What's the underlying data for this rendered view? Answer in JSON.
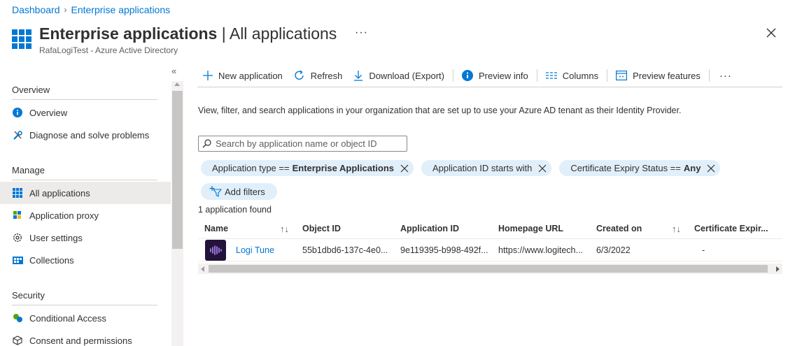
{
  "breadcrumb": {
    "items": [
      "Dashboard",
      "Enterprise applications"
    ]
  },
  "header": {
    "title_main": "Enterprise applications",
    "title_sep": " | ",
    "title_sub": "All applications",
    "subtitle": "RafaLogiTest - Azure Active Directory",
    "more": "···",
    "icon": "app-grid-icon"
  },
  "sidebar": {
    "collapse": "«",
    "sections": [
      {
        "label": "Overview",
        "items": [
          {
            "label": "Overview",
            "icon": "info-icon"
          },
          {
            "label": "Diagnose and solve problems",
            "icon": "wrench-icon"
          }
        ]
      },
      {
        "label": "Manage",
        "items": [
          {
            "label": "All applications",
            "icon": "grid-icon",
            "active": true
          },
          {
            "label": "Application proxy",
            "icon": "proxy-icon"
          },
          {
            "label": "User settings",
            "icon": "gear-icon"
          },
          {
            "label": "Collections",
            "icon": "collections-icon"
          }
        ]
      },
      {
        "label": "Security",
        "items": [
          {
            "label": "Conditional Access",
            "icon": "conditional-access-icon"
          },
          {
            "label": "Consent and permissions",
            "icon": "cube-icon"
          }
        ]
      }
    ]
  },
  "toolbar": {
    "new_application": "New application",
    "refresh": "Refresh",
    "download": "Download (Export)",
    "preview_info": "Preview info",
    "columns": "Columns",
    "preview_features": "Preview features",
    "more": "···"
  },
  "description": "View, filter, and search applications in your organization that are set up to use your Azure AD tenant as their Identity Provider.",
  "search": {
    "placeholder": "Search by application name or object ID",
    "value": ""
  },
  "filters": [
    {
      "label": "Application type == ",
      "value": "Enterprise Applications"
    },
    {
      "label": "Application ID starts with",
      "value": ""
    },
    {
      "label": "Certificate Expiry Status == ",
      "value": "Any"
    }
  ],
  "add_filters": "Add filters",
  "result_count": "1 application found",
  "table": {
    "columns": [
      "Name",
      "Object ID",
      "Application ID",
      "Homepage URL",
      "Created on",
      "Certificate Expir..."
    ],
    "sort_icon": "↑↓",
    "rows": [
      {
        "name": "Logi Tune",
        "object_id": "55b1dbd6-137c-4e0...",
        "application_id": "9e119395-b998-492f...",
        "homepage_url": "https://www.logitech...",
        "created_on": "6/3/2022",
        "certificate_expiry": "-"
      }
    ]
  },
  "colors": {
    "accent": "#0078d4",
    "pill_bg": "#e1effa",
    "logo_bg": "#23133a",
    "logo_wave": "#b68cff"
  }
}
